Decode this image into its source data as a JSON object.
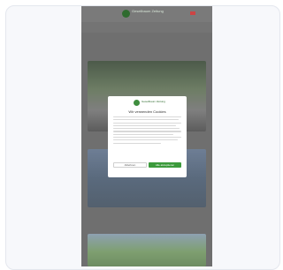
{
  "site": {
    "logo_title": "Geseilbaum Zeitung",
    "logo_subtitle": "",
    "login": "",
    "nav_items": [
      "",
      "",
      "",
      "",
      "",
      "",
      ""
    ]
  },
  "articles": [
    {
      "title": ""
    },
    {
      "title": ""
    }
  ],
  "consent": {
    "logo_text": "Geseilbaum Zeitung",
    "title": "Wir verwenden Cookies",
    "deny_label": "Ablehnen",
    "accept_label": "Alle akzeptieren",
    "links": ""
  },
  "colors": {
    "accent_green": "#3c9a3c",
    "overlay_gray": "#6f6f6f"
  }
}
